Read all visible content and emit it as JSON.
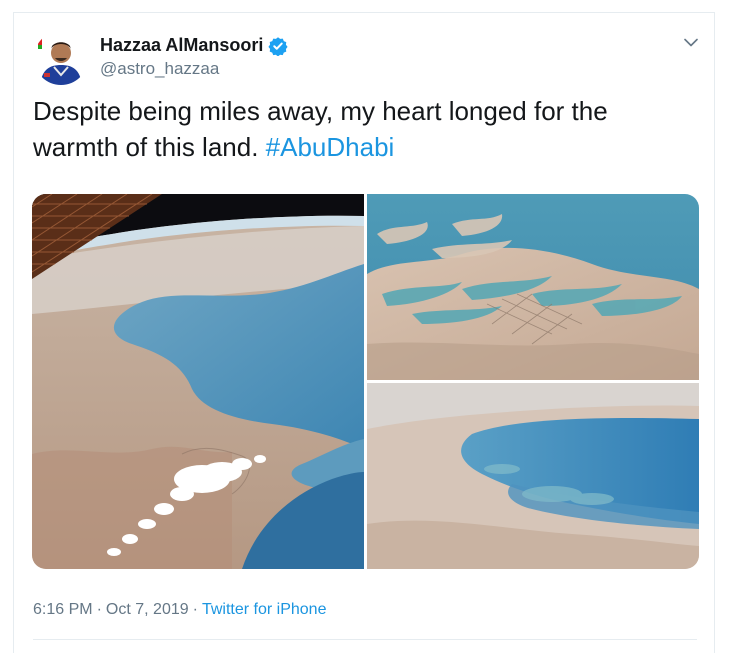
{
  "tweet": {
    "author": {
      "display_name": "Hazzaa AlMansoori",
      "handle": "@astro_hazzaa",
      "verified": true,
      "avatar": "astronaut-avatar"
    },
    "text_plain": "Despite being miles away, my heart longed for the warmth of this land.",
    "hashtag": "#AbuDhabi",
    "images": [
      {
        "name": "earth-coastline-photo",
        "icon": "satellite-earth-image"
      },
      {
        "name": "abu-dhabi-islands-photo",
        "icon": "satellite-earth-image"
      },
      {
        "name": "gulf-coast-photo",
        "icon": "satellite-earth-image"
      }
    ],
    "time": "6:16 PM",
    "separator": "·",
    "date": "Oct 7, 2019",
    "source": "Twitter for iPhone"
  },
  "colors": {
    "link": "#1b95e0",
    "secondary_text": "#657786",
    "verified": "#1da1f2",
    "divider": "#e6ecf0"
  },
  "icons": {
    "verified": "verified-badge-icon",
    "more": "chevron-down-icon"
  }
}
